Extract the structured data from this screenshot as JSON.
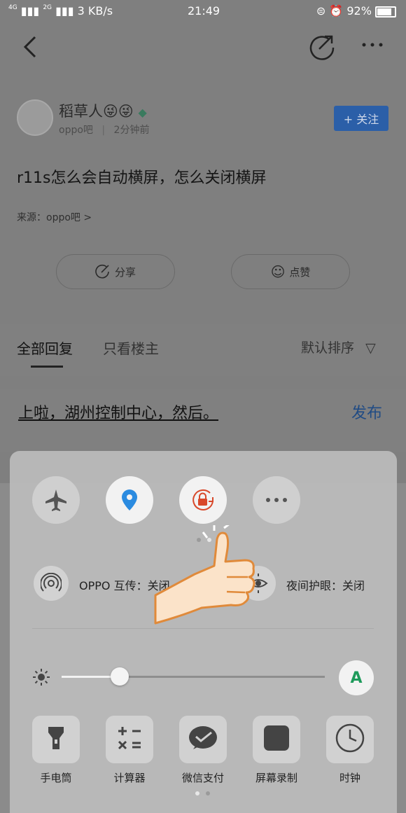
{
  "status_bar": {
    "net_left": "4G",
    "net_right": "2G",
    "speed": "3 KB/s",
    "time": "21:49",
    "battery": "92%"
  },
  "post": {
    "author": "稻草人😜😜",
    "forum": "oppo吧",
    "time_ago": "2分钟前",
    "follow_label": "+ 关注",
    "title": "r11s怎么会自动横屏，怎么关闭横屏",
    "source": "来源：oppo吧 >",
    "share_label": "分享",
    "like_label": "点赞"
  },
  "tabs": {
    "all": "全部回复",
    "op_only": "只看楼主",
    "sort": "默认排序"
  },
  "reply": {
    "text": "上啦，湖州控制中心，然后。",
    "publish": "发布"
  },
  "control_center": {
    "options": {
      "oppo_share": "OPPO 互传：关闭",
      "night_mode": "夜间护眼：关闭"
    },
    "brightness": {
      "level": 0.22,
      "auto_label": "A"
    },
    "tools": [
      {
        "label": "手电筒",
        "icon": "flashlight-icon"
      },
      {
        "label": "计算器",
        "icon": "calculator-icon"
      },
      {
        "label": "微信支付",
        "icon": "wechat-pay-icon"
      },
      {
        "label": "屏幕录制",
        "icon": "screen-record-icon"
      },
      {
        "label": "时钟",
        "icon": "clock-icon"
      }
    ]
  },
  "colors": {
    "accent_blue": "#2b8be0",
    "lock_red": "#d8482a",
    "auto_green": "#1d9a5a"
  }
}
